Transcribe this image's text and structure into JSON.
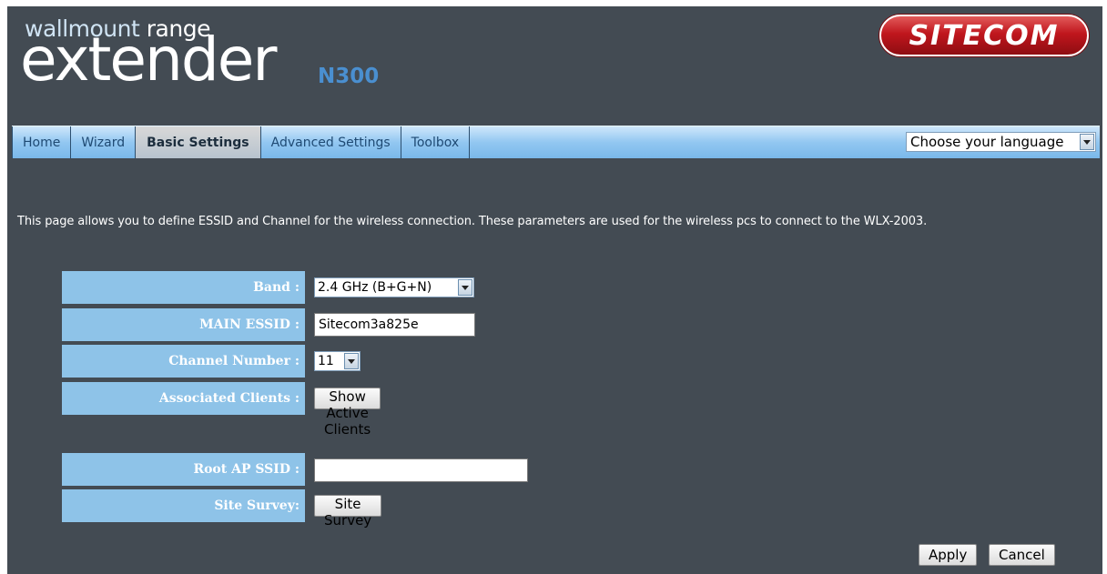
{
  "branding": {
    "line1_light": "wallmount",
    "line1_bold": " range",
    "product": "extender",
    "model": "N300",
    "logo_text": "SITECOM"
  },
  "nav": {
    "tabs": [
      {
        "label": "Home"
      },
      {
        "label": "Wizard"
      },
      {
        "label": "Basic Settings"
      },
      {
        "label": "Advanced Settings"
      },
      {
        "label": "Toolbox"
      }
    ],
    "active_tab": "Basic Settings",
    "language_select": "Choose your language"
  },
  "description": "This page allows you to define ESSID and Channel for the wireless connection. These parameters are used for the wireless pcs to connect to the WLX-2003.",
  "form": {
    "band_label": "Band :",
    "band_value": "2.4 GHz (B+G+N)",
    "essid_label": "MAIN ESSID :",
    "essid_value": "Sitecom3a825e",
    "channel_label": "Channel Number :",
    "channel_value": "11",
    "clients_label": "Associated Clients :",
    "clients_button": "Show Active Clients",
    "root_ssid_label": "Root AP SSID :",
    "root_ssid_value": "",
    "survey_label": "Site Survey:",
    "survey_button": "Site Survey"
  },
  "actions": {
    "apply": "Apply",
    "cancel": "Cancel"
  },
  "colors": {
    "background": "#434b53",
    "label_cell": "#8ec3e8",
    "logo_red": "#c0161d"
  }
}
